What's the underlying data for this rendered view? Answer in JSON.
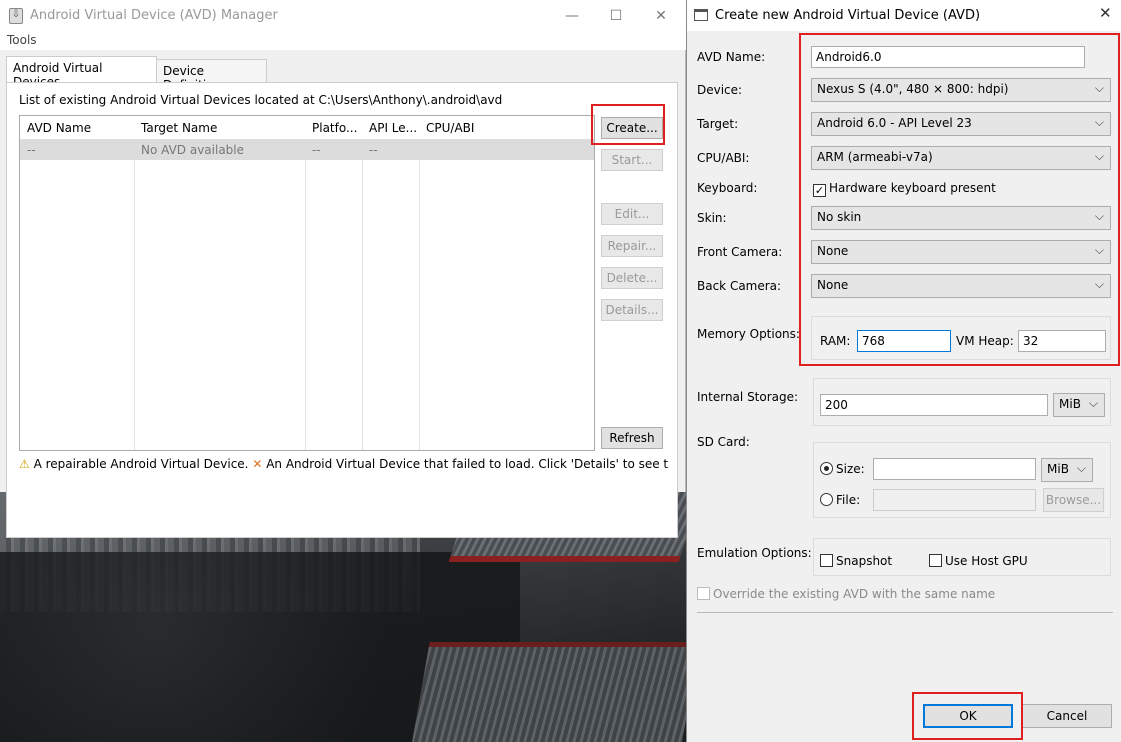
{
  "manager": {
    "title": "Android Virtual Device (AVD) Manager",
    "window_controls": {
      "minimize": "—",
      "maximize": "☐",
      "close": "✕"
    },
    "menu": [
      "Tools"
    ],
    "tabs": [
      {
        "label": "Android Virtual Devices",
        "active": true
      },
      {
        "label": "Device Definitions",
        "active": false
      }
    ],
    "list_label": "List of existing Android Virtual Devices located at C:\\Users\\Anthony\\.android\\avd",
    "table": {
      "columns": [
        "AVD Name",
        "Target Name",
        "Platfo...",
        "API Le...",
        "CPU/ABI"
      ],
      "rows": [
        [
          "--",
          "No AVD available",
          "--",
          "--",
          ""
        ]
      ]
    },
    "buttons": {
      "create": "Create...",
      "start": "Start...",
      "edit": "Edit...",
      "repair": "Repair...",
      "delete": "Delete...",
      "details": "Details...",
      "refresh": "Refresh"
    },
    "legend": {
      "warn_icon": "warning-icon",
      "warn_text": "A repairable Android Virtual Device.",
      "error_icon": "error-x-icon",
      "error_text": "An Android Virtual Device that failed to load. Click 'Details' to see the error."
    }
  },
  "dialog": {
    "title": "Create new Android Virtual Device (AVD)",
    "close": "✕",
    "labels": {
      "avd_name": "AVD Name:",
      "device": "Device:",
      "target": "Target:",
      "cpu_abi": "CPU/ABI:",
      "keyboard": "Keyboard:",
      "skin": "Skin:",
      "front_camera": "Front Camera:",
      "back_camera": "Back Camera:",
      "memory_options": "Memory Options:",
      "ram": "RAM:",
      "vm_heap": "VM Heap:",
      "internal_storage": "Internal Storage:",
      "sd_card": "SD Card:",
      "size": "Size:",
      "file": "File:",
      "emulation_options": "Emulation Options:"
    },
    "values": {
      "avd_name": "Android6.0",
      "device": "Nexus S (4.0\", 480 × 800: hdpi)",
      "target": "Android 6.0 - API Level 23",
      "cpu_abi": "ARM (armeabi-v7a)",
      "keyboard": "Hardware keyboard present",
      "keyboard_checked": true,
      "skin": "No skin",
      "front_camera": "None",
      "back_camera": "None",
      "ram": "768",
      "vm_heap": "32",
      "internal_storage": "200",
      "internal_storage_unit": "MiB",
      "sd_size": "",
      "sd_size_unit": "MiB",
      "sd_file": "",
      "sd_mode": "size",
      "snapshot": "Snapshot",
      "use_host_gpu": "Use Host GPU",
      "override": "Override the existing AVD with the same name"
    },
    "buttons": {
      "browse": "Browse...",
      "ok": "OK",
      "cancel": "Cancel"
    },
    "arrow": "⌵"
  },
  "colors": {
    "highlight_red": "#e02020",
    "accent_blue": "#0078d7",
    "window_bg": "#f0f0f0"
  }
}
